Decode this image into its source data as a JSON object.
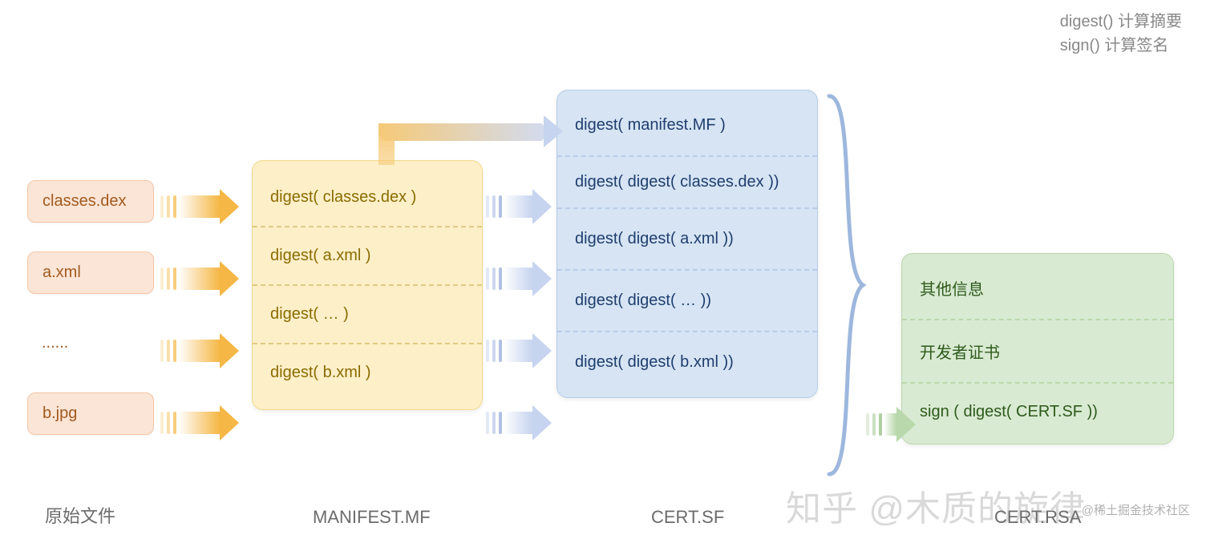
{
  "legend": {
    "line1": "digest() 计算摘要",
    "line2": "sign() 计算签名"
  },
  "labels": {
    "col1": "原始文件",
    "col2": "MANIFEST.MF",
    "col3": "CERT.SF",
    "col4": "CERT.RSA"
  },
  "source_files": {
    "items": [
      "classes.dex",
      "a.xml",
      "......",
      "b.jpg"
    ]
  },
  "manifest_mf": {
    "rows": [
      "digest( classes.dex )",
      "digest( a.xml )",
      "digest( … )",
      "digest( b.xml )"
    ]
  },
  "cert_sf": {
    "rows": [
      "digest( manifest.MF )",
      "digest( digest( classes.dex ))",
      "digest( digest( a.xml ))",
      "digest( digest( … ))",
      "digest( digest( b.xml ))"
    ]
  },
  "cert_rsa": {
    "rows": [
      "其他信息",
      "开发者证书",
      "sign ( digest( CERT.SF ))"
    ]
  },
  "watermark": {
    "main": "知乎 @木质的旋律",
    "corner": "@稀土掘金技术社区"
  }
}
